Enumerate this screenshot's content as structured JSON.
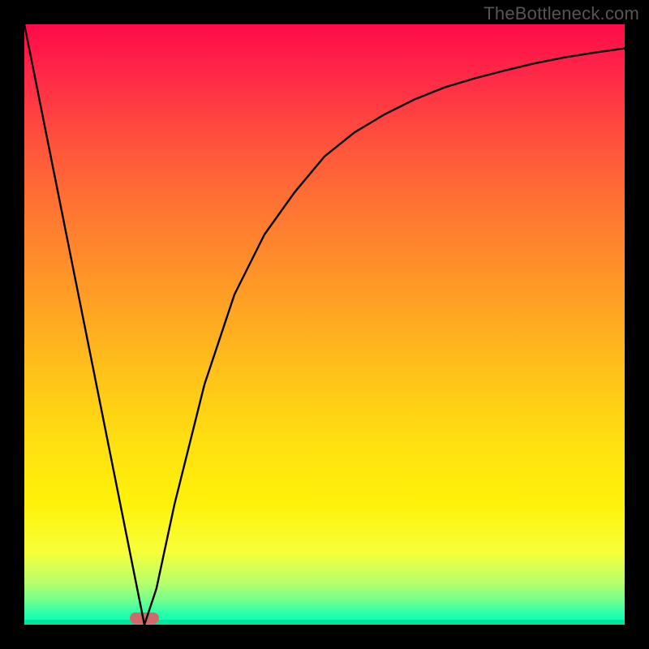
{
  "watermark": "TheBottleneck.com",
  "chart_data": {
    "type": "line",
    "title": "",
    "xlabel": "",
    "ylabel": "",
    "xlim": [
      0,
      100
    ],
    "ylim": [
      0,
      100
    ],
    "grid": false,
    "legend": false,
    "series": [
      {
        "name": "curve",
        "x": [
          0,
          5,
          10,
          15,
          18,
          20,
          22,
          25,
          30,
          35,
          40,
          45,
          50,
          55,
          60,
          65,
          70,
          75,
          80,
          85,
          90,
          95,
          100
        ],
        "y": [
          100,
          75,
          50,
          25,
          10,
          0,
          6,
          20,
          40,
          55,
          65,
          72,
          78,
          82,
          85,
          87.5,
          89.5,
          91,
          92.3,
          93.5,
          94.5,
          95.3,
          96
        ]
      }
    ],
    "marker": {
      "x": 20,
      "y": 0
    },
    "colors": {
      "gradient_top": "#ff0a4a",
      "gradient_mid": "#ffe010",
      "gradient_bottom": "#00ffb0",
      "marker": "#d06a6a",
      "curve": "#000000",
      "frame": "#000000"
    }
  }
}
